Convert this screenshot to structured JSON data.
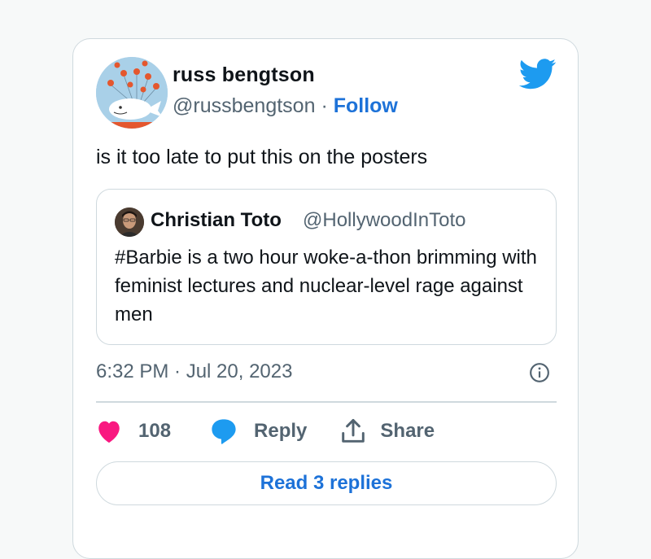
{
  "tweet": {
    "author_name": "russ bengtson",
    "author_handle": "@russbengtson",
    "separator": "·",
    "follow_label": "Follow",
    "text": "is it too late to put this on the posters",
    "timestamp": "6:32 PM · Jul 20, 2023",
    "like_count": "108",
    "reply_label": "Reply",
    "share_label": "Share",
    "read_replies_label": "Read 3 replies"
  },
  "quoted_tweet": {
    "author_name": "Christian Toto",
    "author_handle": "@HollywoodInToto",
    "text": "#Barbie is a two hour woke-a-thon brimming with feminist lectures and nuclear-level rage against men"
  },
  "icons": {
    "brand": "twitter-bird-icon",
    "info": "info-icon",
    "like": "heart-icon",
    "reply": "speech-bubble-icon",
    "share": "share-upload-icon"
  },
  "colors": {
    "twitter_blue": "#1d9bf0",
    "link_blue": "#1d72d8",
    "heart_pink": "#f91880",
    "secondary_text": "#536471",
    "border": "#cfd9de"
  }
}
